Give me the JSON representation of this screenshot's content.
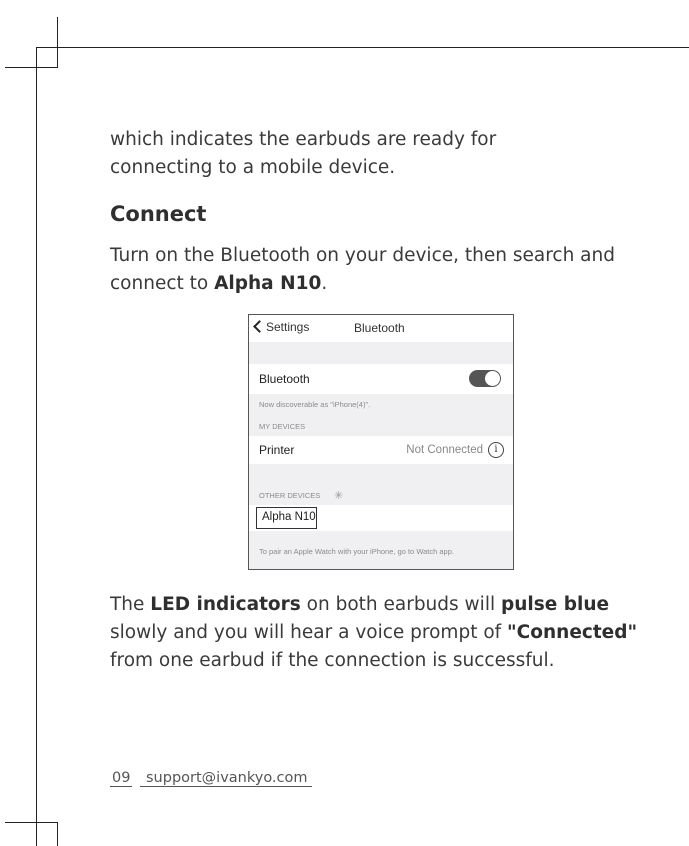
{
  "body": {
    "p1": "which indicates the earbuds are ready for connecting to a mobile device.",
    "heading": "Connect",
    "p2_line1": "Turn on the Bluetooth on your device, then search and",
    "p2_line2_start": "connect to ",
    "p2_device": "Alpha N10",
    "p2_line2_end": ".",
    "p3_a": "The ",
    "p3_led": "LED indicators",
    "p3_b": " on both earbuds will ",
    "p3_pulse": "pulse blue",
    "p3_c": " slowly and you will hear a voice prompt of ",
    "p3_connected": "\"Connected\"",
    "p3_d": " from one earbud if the connection is successful."
  },
  "phone": {
    "back_label": "Settings",
    "nav_title": "Bluetooth",
    "bluetooth_label": "Bluetooth",
    "bluetooth_on": true,
    "discoverable": "Now discoverable as \"iPhone(4)\".",
    "my_devices_header": "MY DEVICES",
    "printer_label": "Printer",
    "printer_status": "Not Connected",
    "info_glyph": "i",
    "other_devices_header": "OTHER DEVICES",
    "alpha_label": "Alpha N10",
    "watch_note": "To pair an Apple Watch with your iPhone, go to Watch app."
  },
  "footer": {
    "page_number": "09",
    "email": "support@ivankyo.com"
  }
}
